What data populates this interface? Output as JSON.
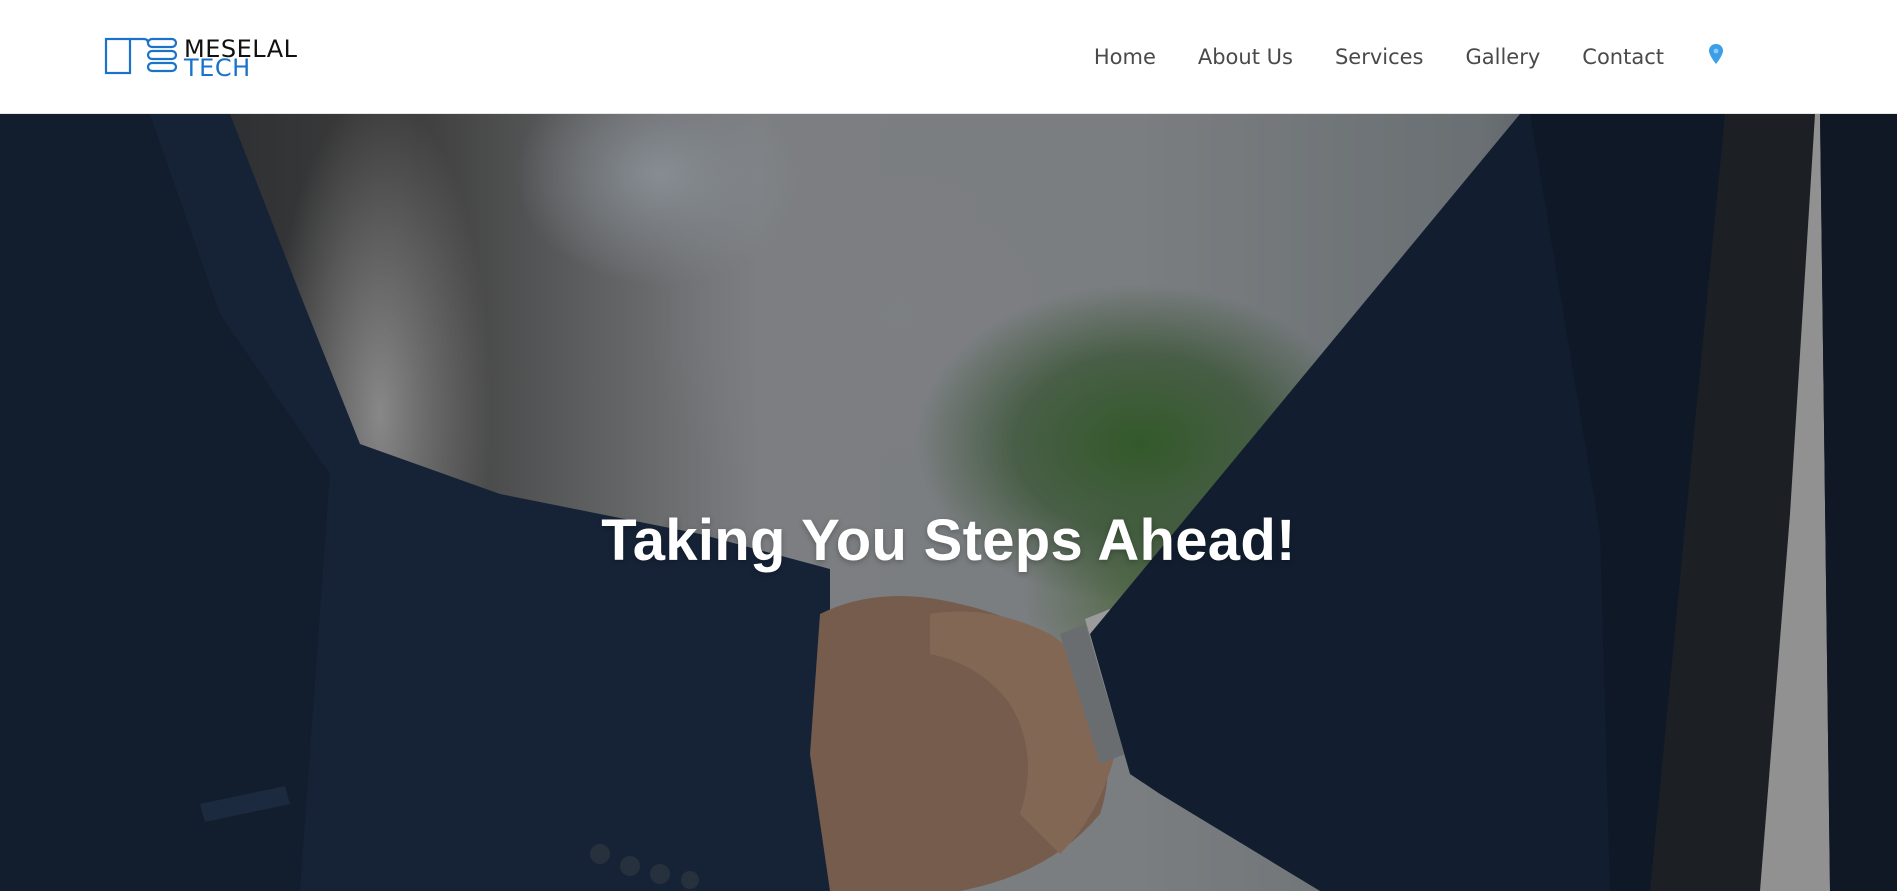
{
  "brand": {
    "name_line1": "MESELAL",
    "name_line2": "TECH",
    "accent_color": "#1a73c9"
  },
  "nav": {
    "items": [
      {
        "label": "Home"
      },
      {
        "label": "About Us"
      },
      {
        "label": "Services"
      },
      {
        "label": "Gallery"
      },
      {
        "label": "Contact"
      }
    ],
    "location_icon": "map-pin-icon",
    "location_icon_color": "#3b9ee8"
  },
  "hero": {
    "title": "Taking You Steps Ahead!",
    "image": "handshake-photo"
  }
}
